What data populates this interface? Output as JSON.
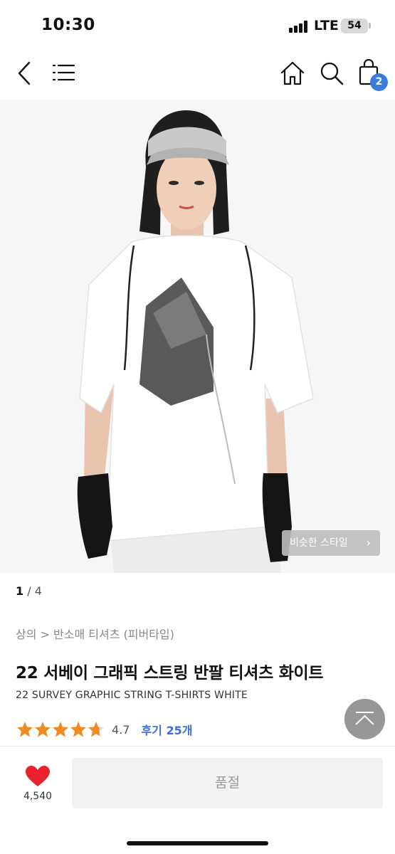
{
  "status_bar": {
    "time": "10:30",
    "network": "LTE",
    "battery": "54"
  },
  "nav": {
    "icons": [
      "back-icon",
      "menu-icon",
      "home-icon",
      "search-icon",
      "cart-icon"
    ],
    "cart_count": "2"
  },
  "gallery": {
    "similar_style_label": "비슷한 스타일",
    "current_page": "1",
    "total_pages": "4"
  },
  "product": {
    "breadcrumb": "상의 > 반소매 티셔츠 (피버타입)",
    "title": "22 서베이 그래픽 스트링 반팔 티셔츠 화이트",
    "subtitle": "22 SURVEY GRAPHIC STRING T-SHIRTS WHITE",
    "rating": "4.7",
    "rating_stars": 4.7,
    "review_label": "후기 25개"
  },
  "bottom_bar": {
    "wish_count": "4,540",
    "buy_button_label": "품절"
  },
  "colors": {
    "accent_blue": "#3b6fd6",
    "star_orange": "#f08a22",
    "heart_red": "#e8222e"
  }
}
